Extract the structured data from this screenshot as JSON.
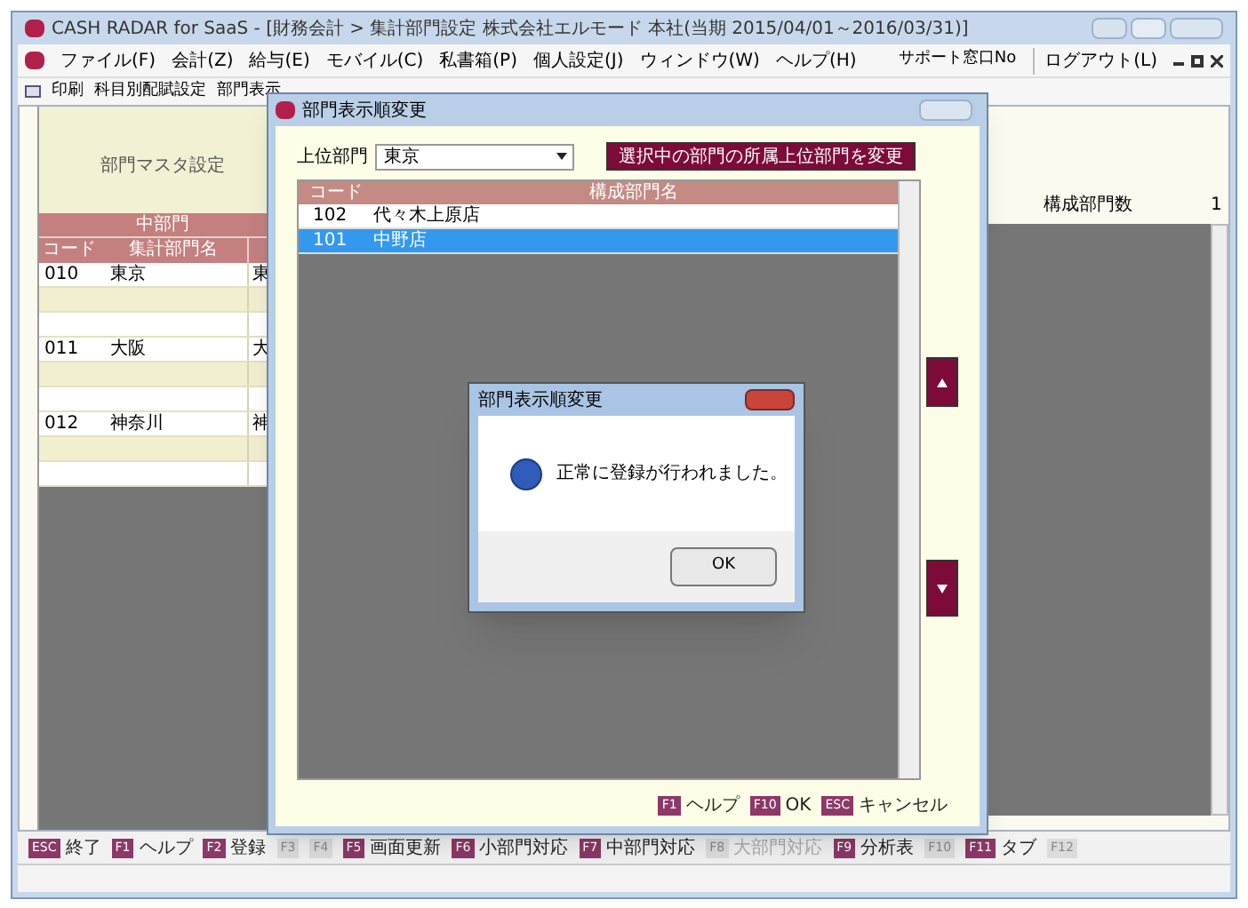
{
  "window": {
    "title": "CASH RADAR for SaaS - [財務会計 > 集計部門設定 株式会社エルモード 本社(当期 2015/04/01～2016/03/31)]"
  },
  "menu": [
    "ファイル(F)",
    "会計(Z)",
    "給与(E)",
    "モバイル(C)",
    "私書箱(P)",
    "個人設定(J)",
    "ウィンドウ(W)",
    "ヘルプ(H)"
  ],
  "menu_right": [
    "サポート窓口No",
    "ログアウト(L)"
  ],
  "toolbar": [
    "印刷",
    "科目別配賦設定",
    "部門表示"
  ],
  "left_panel": {
    "title": "部門マスタ設定",
    "group_header": "中部門",
    "columns": [
      "コード",
      "集計部門名"
    ],
    "rows": [
      {
        "code": "010",
        "name": "東京",
        "column_3": "東"
      },
      {
        "code": "011",
        "name": "大阪",
        "column_3": "大"
      },
      {
        "code": "012",
        "name": "神奈川",
        "column_3": "神"
      }
    ]
  },
  "right_panel": {
    "header": "構成部門数",
    "column_2": "1"
  },
  "function_keys": [
    {
      "key": "ESC",
      "label": "終了",
      "disabled": false
    },
    {
      "key": "F1",
      "label": "ヘルプ",
      "disabled": false
    },
    {
      "key": "F2",
      "label": "登録",
      "disabled": false
    },
    {
      "key": "F3",
      "disabled": true
    },
    {
      "key": "F4",
      "disabled": true
    },
    {
      "key": "F5",
      "label": "画面更新",
      "disabled": false
    },
    {
      "key": "F6",
      "label": "小部門対応",
      "disabled": false
    },
    {
      "key": "F7",
      "label": "中部門対応",
      "disabled": false
    },
    {
      "key": "F8",
      "label": "大部門対応",
      "disabled": true
    },
    {
      "key": "F9",
      "label": "分析表",
      "disabled": false
    },
    {
      "key": "F10",
      "disabled": true
    },
    {
      "key": "F11",
      "label": "タブ",
      "disabled": false
    },
    {
      "key": "F12",
      "disabled": true
    }
  ],
  "dialog": {
    "title": "部門表示順変更",
    "parent_label": "上位部門",
    "parent_value": "東京",
    "change_button": "選択中の部門の所属上位部門を変更",
    "columns": [
      "コード",
      "構成部門名"
    ],
    "rows": [
      {
        "code": "102",
        "name": "代々木上原店",
        "selected": false
      },
      {
        "code": "101",
        "name": "中野店",
        "selected": true
      }
    ],
    "keys": [
      {
        "key": "F1",
        "label": "ヘルプ"
      },
      {
        "key": "F10",
        "label": "OK"
      },
      {
        "key": "ESC",
        "label": "キャンセル"
      }
    ]
  },
  "message_box": {
    "title": "部門表示順変更",
    "message": "正常に登録が行われました。",
    "ok_button": "OK"
  }
}
